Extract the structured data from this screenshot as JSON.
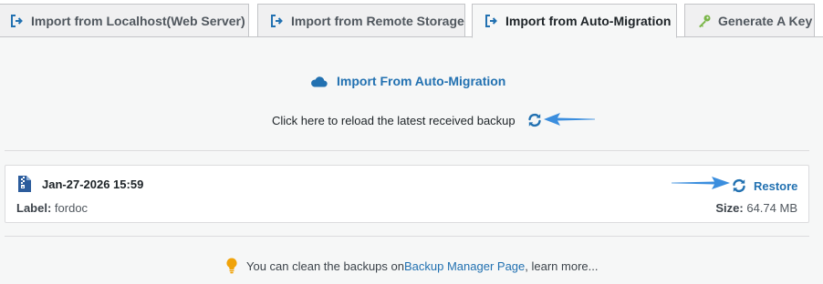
{
  "tabs": [
    {
      "label": "Import from Localhost(Web Server)",
      "icon": "import-icon",
      "active": false
    },
    {
      "label": "Import from Remote Storage",
      "icon": "import-icon",
      "active": false
    },
    {
      "label": "Import from Auto-Migration",
      "icon": "import-icon",
      "active": true
    },
    {
      "label": "Generate A Key",
      "icon": "key-icon",
      "active": false
    }
  ],
  "panel": {
    "heading": "Import From Auto-Migration",
    "reload_text": "Click here to reload the latest received backup"
  },
  "backup": {
    "date": "Jan-27-2026 15:59",
    "label_key": "Label:",
    "label_value": "fordoc",
    "restore_label": "Restore",
    "size_key": "Size:",
    "size_value": "64.74 MB"
  },
  "note": {
    "before": "You can clean the backups on ",
    "link": "Backup Manager Page",
    "after": ", learn more..."
  },
  "colors": {
    "accent": "#2271b1",
    "arrow": "#3b8ede",
    "key": "#7ab648",
    "bulb": "#f0a30a",
    "zip": "#2c5c9c"
  }
}
